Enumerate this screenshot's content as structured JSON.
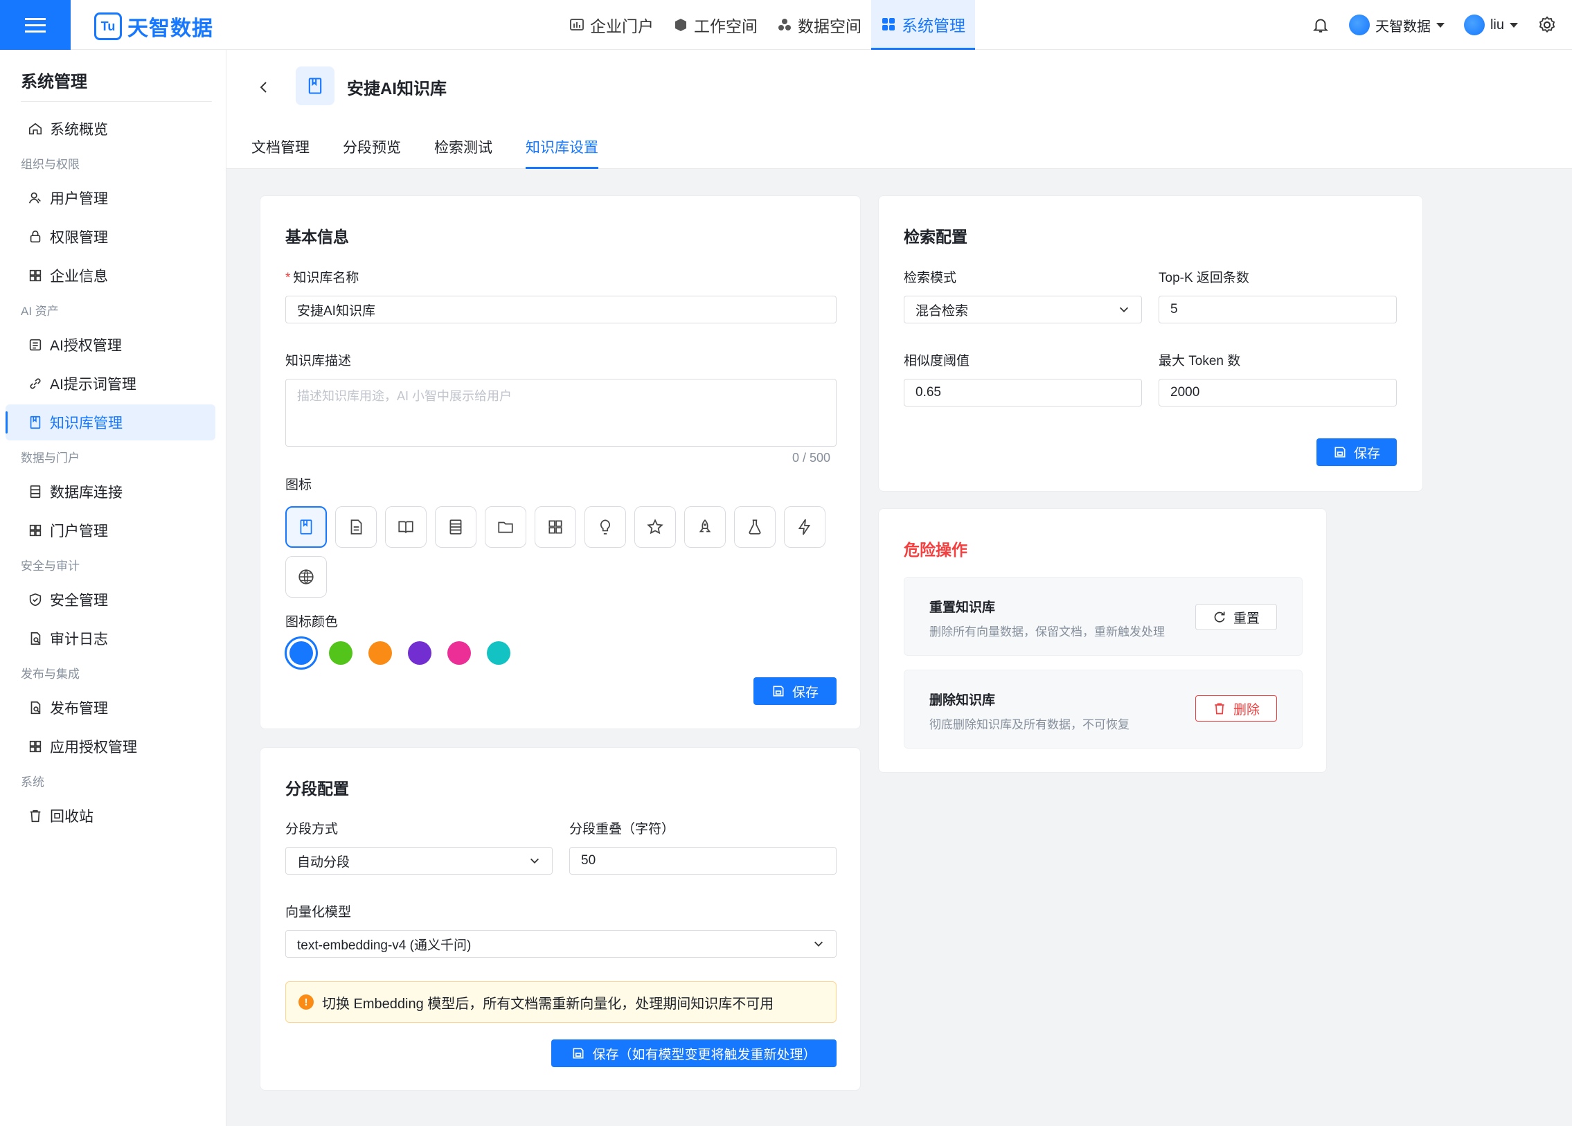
{
  "app": {
    "logo_mark": "Tu",
    "brand": "天智数据"
  },
  "topnav": [
    {
      "label": "企业门户",
      "icon": "chart-icon"
    },
    {
      "label": "工作空间",
      "icon": "cube-icon"
    },
    {
      "label": "数据空间",
      "icon": "cubes-icon"
    },
    {
      "label": "系统管理",
      "icon": "grid-icon",
      "active": true
    }
  ],
  "topright": {
    "org": "天智数据",
    "user": "liu"
  },
  "sidebar": {
    "title": "系统管理",
    "overview": "系统概览",
    "groups": {
      "org": "组织与权限",
      "ai": "AI 资产",
      "data": "数据与门户",
      "security": "安全与审计",
      "release": "发布与集成",
      "system": "系统"
    },
    "items": {
      "users": "用户管理",
      "perms": "权限管理",
      "company": "企业信息",
      "ai_auth": "AI授权管理",
      "ai_prompt": "AI提示词管理",
      "kb": "知识库管理",
      "db": "数据库连接",
      "portal": "门户管理",
      "security": "安全管理",
      "audit": "审计日志",
      "publish": "发布管理",
      "app_auth": "应用授权管理",
      "recycle": "回收站"
    }
  },
  "page": {
    "title": "安捷AI知识库",
    "tabs": [
      "文档管理",
      "分段预览",
      "检索测试",
      "知识库设置"
    ],
    "active_tab": 3
  },
  "basic": {
    "title": "基本信息",
    "name_label": "知识库名称",
    "name_value": "安捷AI知识库",
    "desc_label": "知识库描述",
    "desc_placeholder": "描述知识库用途，AI 小智中展示给用户",
    "desc_counter": "0 / 500",
    "icon_label": "图标",
    "color_label": "图标颜色",
    "colors": [
      "#1677ff",
      "#52c41a",
      "#fa8c16",
      "#722ed1",
      "#eb2f96",
      "#13c2c2"
    ],
    "save": "保存"
  },
  "segment": {
    "title": "分段配置",
    "mode_label": "分段方式",
    "mode_value": "自动分段",
    "overlap_label": "分段重叠（字符）",
    "overlap_value": "50",
    "model_label": "向量化模型",
    "model_value": "text-embedding-v4 (通义千问)",
    "warning": "切换 Embedding 模型后，所有文档需重新向量化，处理期间知识库不可用",
    "save": "保存（如有模型变更将触发重新处理）"
  },
  "retrieval": {
    "title": "检索配置",
    "mode_label": "检索模式",
    "mode_value": "混合检索",
    "topk_label": "Top-K 返回条数",
    "topk_value": "5",
    "threshold_label": "相似度阈值",
    "threshold_value": "0.65",
    "maxtoken_label": "最大 Token 数",
    "maxtoken_value": "2000",
    "save": "保存"
  },
  "danger": {
    "title": "危险操作",
    "reset_title": "重置知识库",
    "reset_desc": "删除所有向量数据，保留文档，重新触发处理",
    "reset_btn": "重置",
    "delete_title": "删除知识库",
    "delete_desc": "彻底删除知识库及所有数据，不可恢复",
    "delete_btn": "删除"
  }
}
